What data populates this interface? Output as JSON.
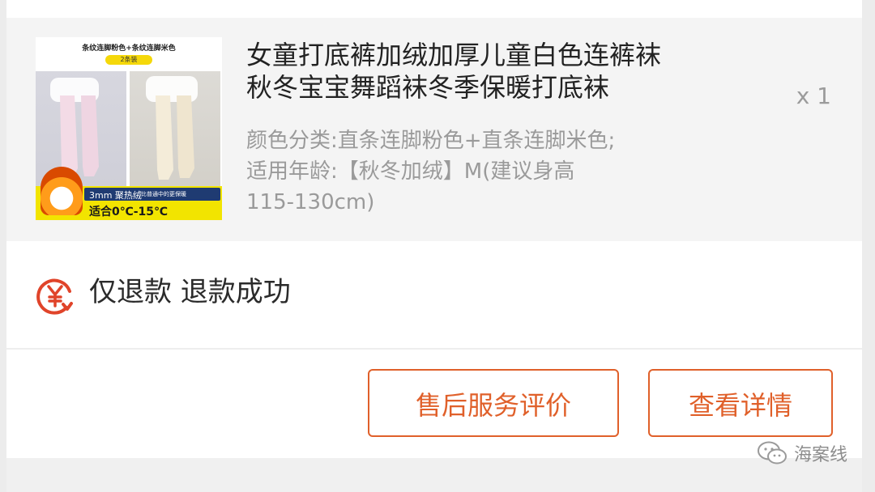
{
  "order_item": {
    "thumbnail": {
      "title": "条纹连脚粉色+条纹连脚米色",
      "pill": "2条装",
      "spec": "3mm 聚热绒",
      "spec_note": "比普通中的更保暖",
      "temperature": "适合0℃-15℃"
    },
    "title_line1": "女童打底裤加绒加厚儿童白色连裤袜",
    "title_line2": "秋冬宝宝舞蹈袜冬季保暖打底袜",
    "quantity": "x 1",
    "sku_line1": "颜色分类:直条连脚粉色+直条连脚米色;",
    "sku_line2": "适用年龄:【秋冬加绒】M(建议身高",
    "sku_line3": "115-130cm)"
  },
  "refund": {
    "icon": "yen-refund-icon",
    "status_text": "仅退款 退款成功"
  },
  "actions": {
    "review_label": "售后服务评价",
    "details_label": "查看详情"
  },
  "watermark": {
    "icon": "wechat-icon",
    "text": "海案线"
  },
  "colors": {
    "accent": "#e0602a",
    "refund_icon_red": "#e0442a",
    "card_bg": "#f4f4f4",
    "title_text": "#222222",
    "muted_text": "#9a9a9a"
  }
}
